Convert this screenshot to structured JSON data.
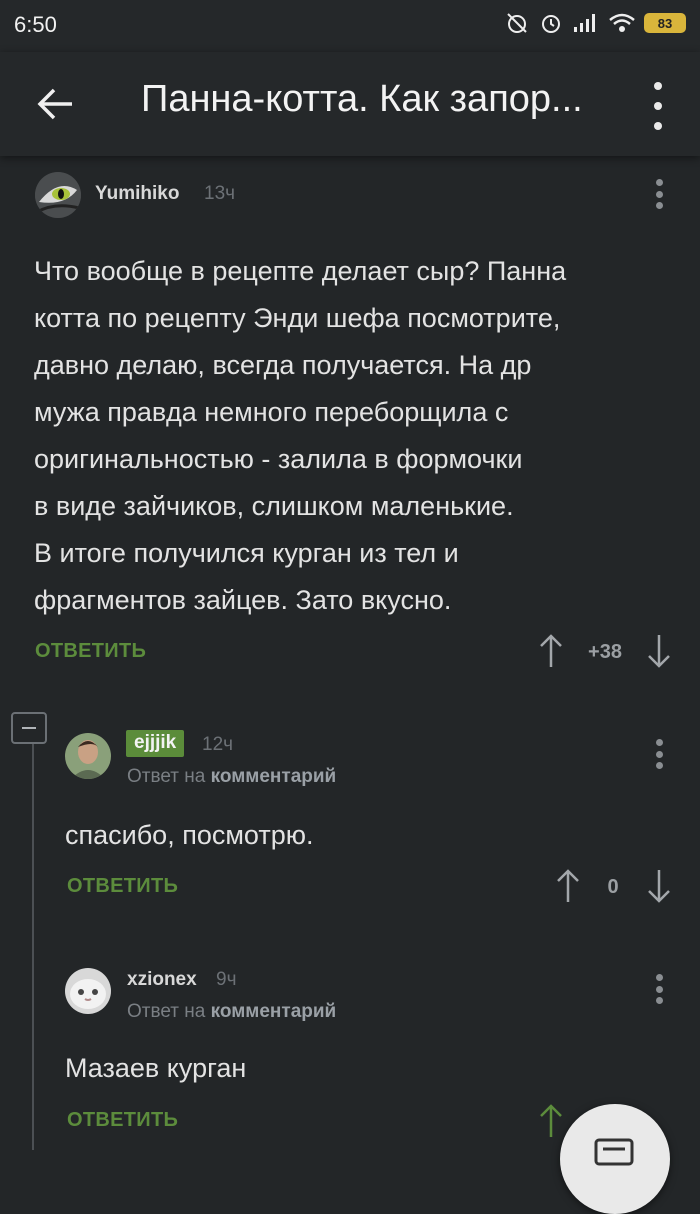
{
  "status_bar": {
    "time": "6:50",
    "battery": "83"
  },
  "app_bar": {
    "title": "Панна-котта. Как запор..."
  },
  "comments": [
    {
      "username": "Yumihiko",
      "time": "13ч",
      "text_lines": [
        "Что вообще в рецепте делает сыр? Панна",
        "котта по рецепту Энди шефа посмотрите,",
        "давно делаю, всегда получается. На др",
        "мужа правда немного переборщила с",
        "оригинальностью - залила в формочки",
        "в виде зайчиков, слишком маленькие.",
        "В итоге получился курган из тел и",
        "фрагментов зайцев. Зато вкусно."
      ],
      "reply_label": "ОТВЕТИТЬ",
      "rating": "+38"
    },
    {
      "username": "ejjjik",
      "time": "12ч",
      "reply_to_prefix": "Ответ на",
      "reply_to_target": "комментарий",
      "text": "спасибо, посмотрю.",
      "reply_label": "ОТВЕТИТЬ",
      "rating": "0"
    },
    {
      "username": "xzionex",
      "time": "9ч",
      "reply_to_prefix": "Ответ на",
      "reply_to_target": "комментарий",
      "text": "Мазаев курган",
      "reply_label": "ОТВЕТИТЬ",
      "rating": ""
    }
  ],
  "colors": {
    "background": "#232628",
    "accent_green": "#5c8c3c",
    "text": "#e3e3e3"
  }
}
